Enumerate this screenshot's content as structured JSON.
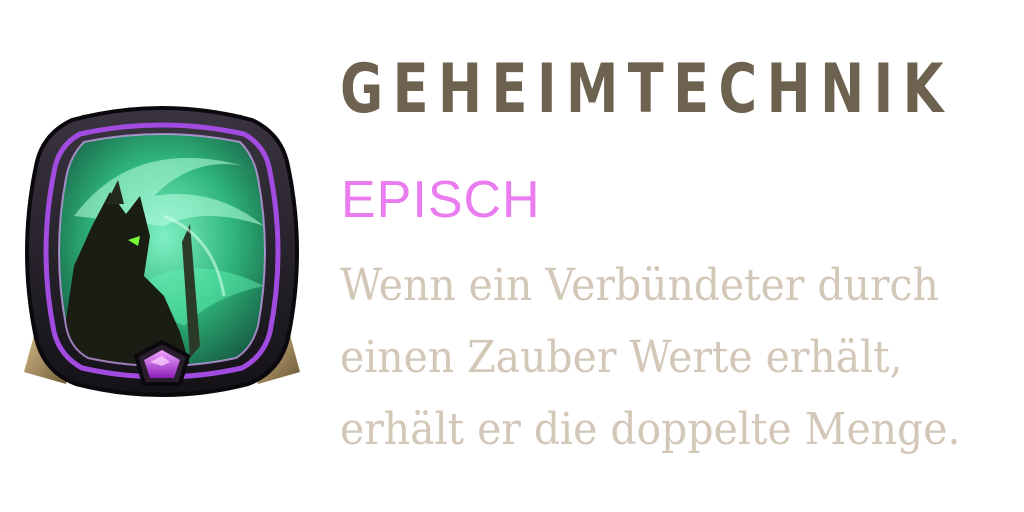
{
  "card": {
    "title": "GEHEIMTECHNIK",
    "rarity": "EPISCH",
    "description_lines": [
      "Wenn ein Verbündeter durch",
      "einen Zauber Werte erhält,",
      "erhält er die doppelte Menge."
    ],
    "icon": "shadow-warrior-artwork-icon",
    "rarity_gem_icon": "pentagon-gem-icon"
  },
  "colors": {
    "title": "#6d6150",
    "rarity": "#ea7cf0",
    "description": "#d3c7b7",
    "frame_purple": "#a24be0",
    "art_green": "#3ee39a"
  }
}
